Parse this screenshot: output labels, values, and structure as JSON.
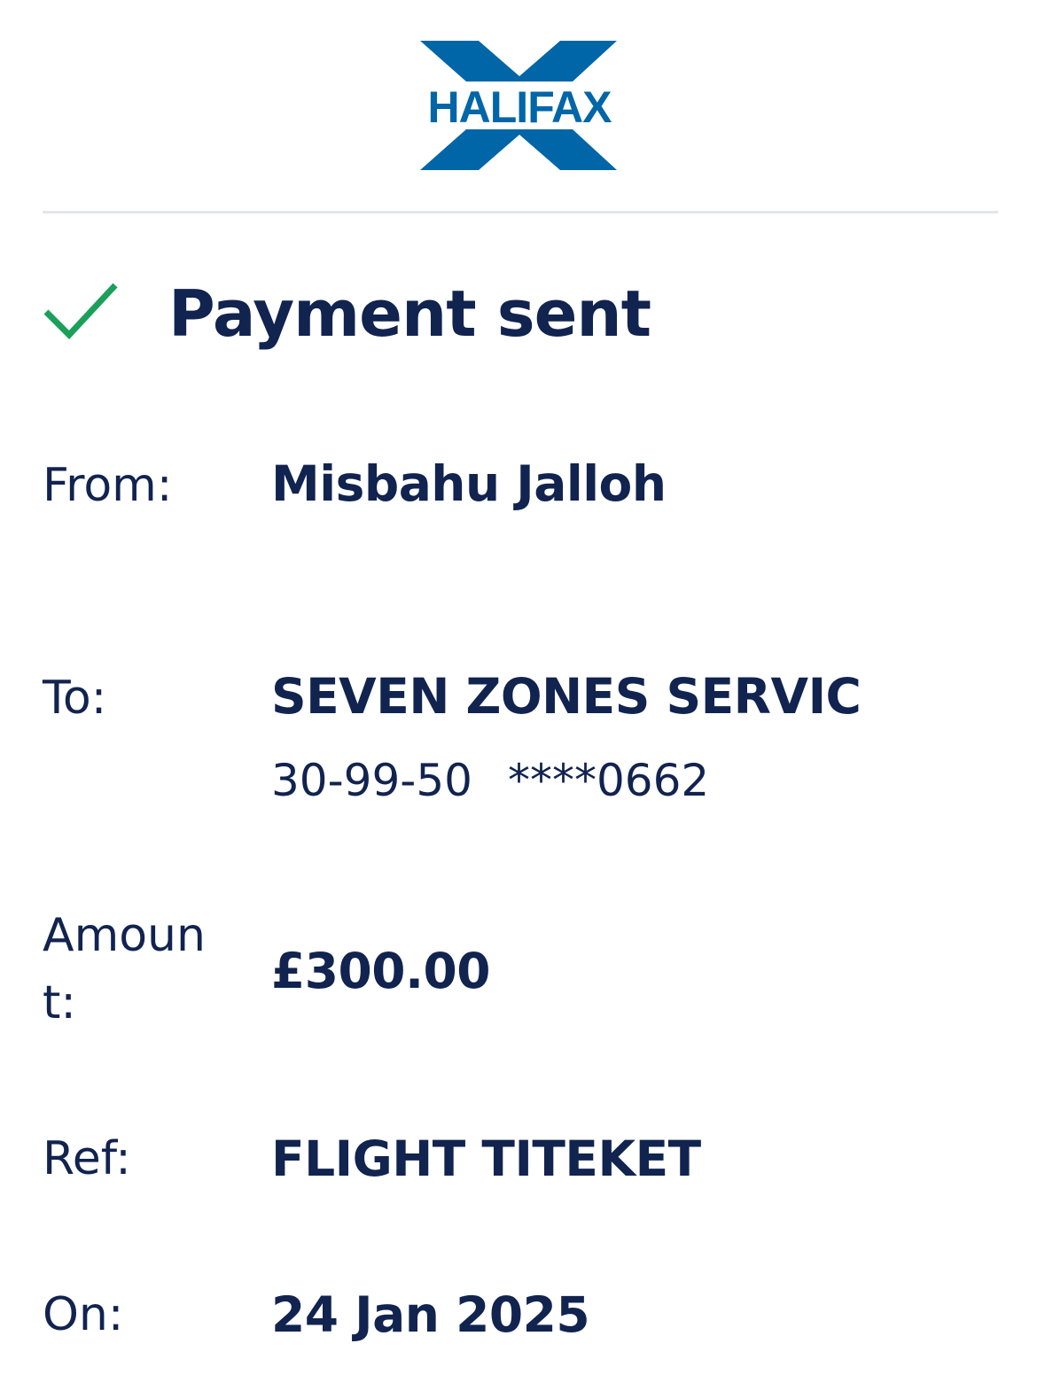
{
  "brand": {
    "name": "HALIFAX",
    "primary_color": "#0066a8",
    "text_color": "#11234f",
    "success_color": "#1aa05a"
  },
  "status": {
    "icon": "check-icon",
    "title": "Payment sent"
  },
  "details": {
    "from": {
      "label": "From:",
      "value": "Misbahu Jalloh"
    },
    "to": {
      "label": "To:",
      "value": "SEVEN ZONES SERVIC",
      "sort_code": "30-99-50",
      "account": "****0662"
    },
    "amount": {
      "label": "Amount:",
      "value": "£300.00"
    },
    "ref": {
      "label": "Ref:",
      "value": "FLIGHT TITEKET"
    },
    "on": {
      "label": "On:",
      "value": "24 Jan 2025"
    }
  }
}
